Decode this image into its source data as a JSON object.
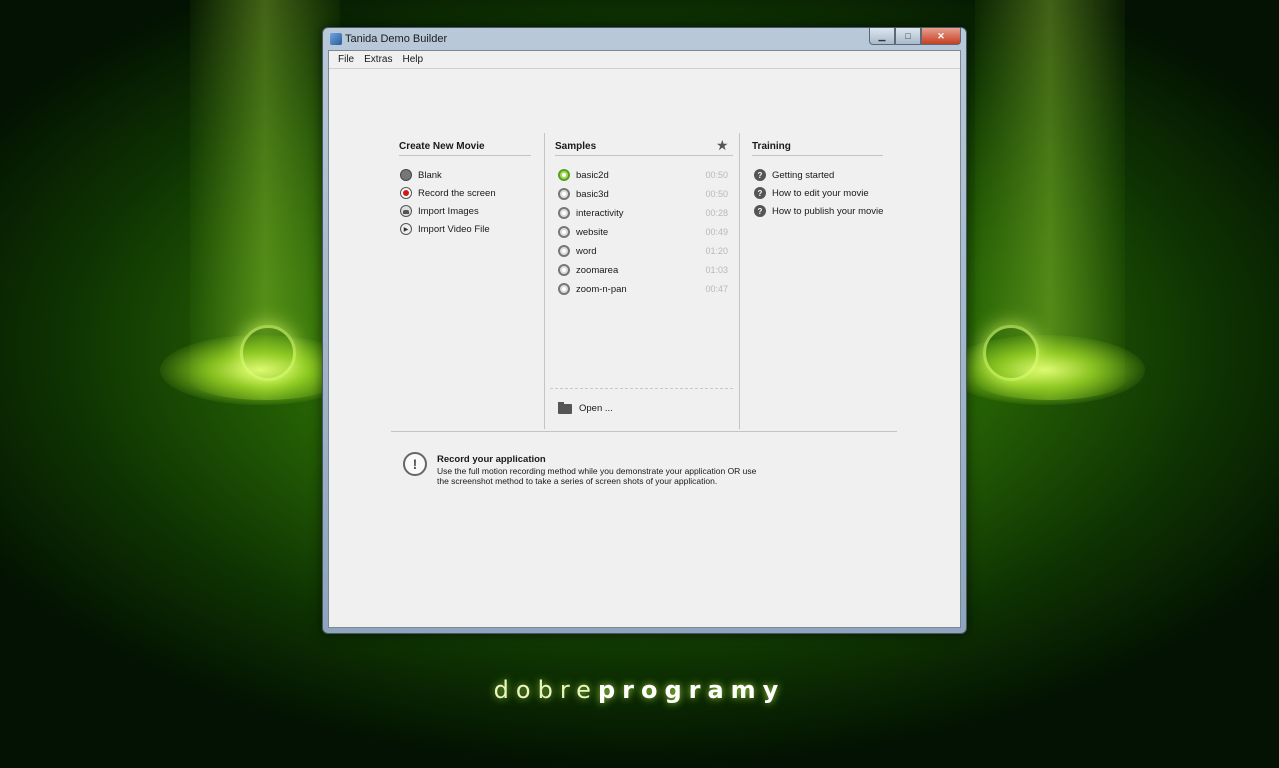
{
  "window": {
    "title": "Tanida Demo Builder",
    "controls": {
      "minimize": "▁",
      "maximize": "□",
      "close": "✕"
    }
  },
  "menu": [
    "File",
    "Extras",
    "Help"
  ],
  "create": {
    "title": "Create New Movie",
    "items": [
      {
        "label": "Blank",
        "icon": "blank-icon"
      },
      {
        "label": "Record the screen",
        "icon": "record-icon"
      },
      {
        "label": "Import Images",
        "icon": "images-icon"
      },
      {
        "label": "Import Video File",
        "icon": "video-file-icon"
      }
    ]
  },
  "samples": {
    "title": "Samples",
    "star": "★",
    "items": [
      {
        "label": "basic2d",
        "time": "00:50"
      },
      {
        "label": "basic3d",
        "time": "00:50"
      },
      {
        "label": "interactivity",
        "time": "00:28"
      },
      {
        "label": "website",
        "time": "00:49"
      },
      {
        "label": "word",
        "time": "01:20"
      },
      {
        "label": "zoomarea",
        "time": "01:03"
      },
      {
        "label": "zoom-n-pan",
        "time": "00:47"
      }
    ],
    "open_label": "Open ..."
  },
  "training": {
    "title": "Training",
    "items": [
      {
        "label": "Getting started"
      },
      {
        "label": "How to edit your movie"
      },
      {
        "label": "How to publish your movie"
      }
    ]
  },
  "info": {
    "icon_glyph": "!",
    "title": "Record your application",
    "text": "Use the full motion recording method while you demonstrate your application OR use the screenshot method to take a series of screen shots of your application."
  },
  "brand": {
    "part1": "dobre",
    "part2": "programy"
  },
  "colors": {
    "desktop": "#2a6a05",
    "record_red": "#d01818",
    "sample_active": "#58a01a"
  }
}
